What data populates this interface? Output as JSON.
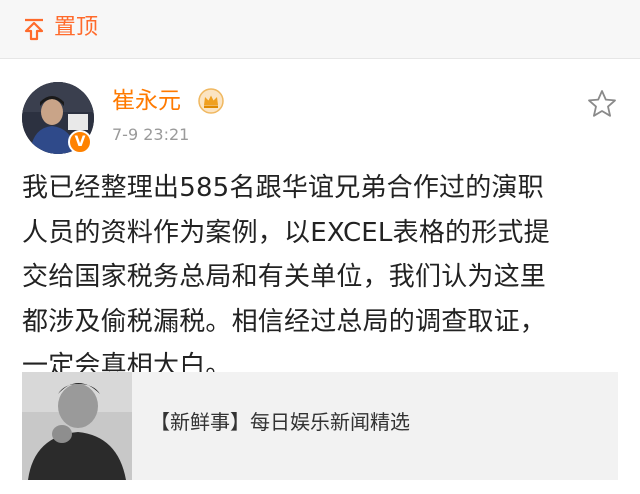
{
  "pin_bar": {
    "icon": "pin-top-icon",
    "label": "置顶"
  },
  "post": {
    "username": "崔永元",
    "badge_icon": "crown-membership-icon",
    "verified_icon": "verified-v-icon",
    "verified_mark": "V",
    "timestamp": "7-9 23:21",
    "favorite_icon": "star-icon",
    "lines": [
      "我已经整理出585名跟华谊兄弟合作过的演职",
      "人员的资料作为案例，以EXCEL表格的形式提",
      "交给国家税务总局和有关单位，我们认为这里",
      "都涉及偷税漏税。相信经过总局的调查取证，",
      "一定会真相大白。"
    ]
  },
  "link_card": {
    "title": "【新鲜事】每日娱乐新闻精选"
  },
  "colors": {
    "accent": "#ff7a00",
    "pin": "#ff6a2b",
    "timestamp": "#9a9a9a",
    "card_bg": "#f2f2f2"
  }
}
